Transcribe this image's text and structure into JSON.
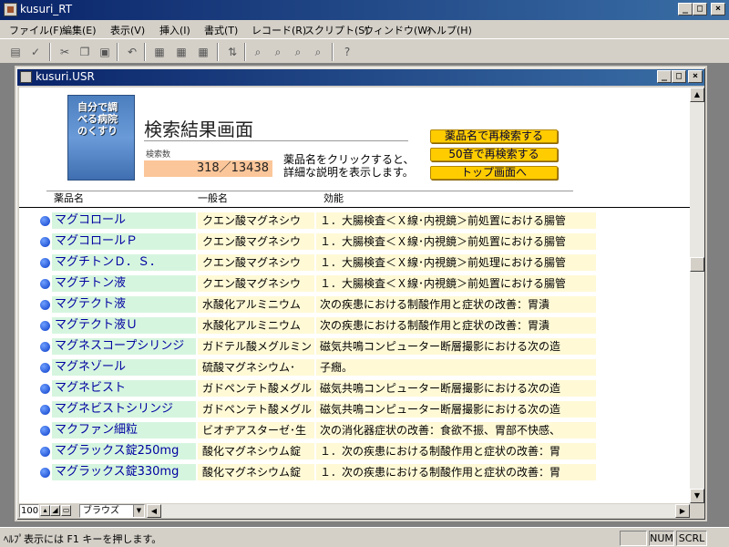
{
  "app": {
    "title": "kusuri_RT"
  },
  "menu": [
    "ファイル(F)",
    "編集(E)",
    "表示(V)",
    "挿入(I)",
    "書式(T)",
    "レコード(R)",
    "スクリプト(S)",
    "ウィンドウ(W)",
    "ヘルプ(H)"
  ],
  "child_window": {
    "title": "kusuri.USR"
  },
  "page": {
    "logo_text": "自分で調べる病院のくすり",
    "title": "検索結果画面",
    "count_label": "検索数",
    "count_value": "318／13438",
    "hint_line1": "薬品名をクリックすると、",
    "hint_line2": "詳細な説明を表示します。",
    "buttons": {
      "research_by_name": "薬品名で再検索する",
      "research_by_kana": "50音で再検索する",
      "top_page": "トップ画面へ"
    },
    "columns": {
      "name": "薬品名",
      "generic": "一般名",
      "effect": "効能"
    }
  },
  "rows": [
    {
      "name": "マグコロール",
      "generic": "クエン酸マグネシウ",
      "effect": "１．大腸検査＜Ｘ線･内視鏡＞前処置における腸管"
    },
    {
      "name": "マグコロールＰ",
      "generic": "クエン酸マグネシウ",
      "effect": "１．大腸検査＜Ｘ線･内視鏡＞前処置における腸管"
    },
    {
      "name": "マグチトンＤ．Ｓ．",
      "generic": "クエン酸マグネシウ",
      "effect": "１．大腸検査＜Ｘ線･内視鏡＞前処理における腸管"
    },
    {
      "name": "マグチトン液",
      "generic": "クエン酸マグネシウ",
      "effect": "１．大腸検査＜Ｘ線･内視鏡＞前処置における腸管"
    },
    {
      "name": "マグテクト液",
      "generic": "水酸化アルミニウム",
      "effect": "次の疾患における制酸作用と症状の改善：胃潰"
    },
    {
      "name": "マグテクト液Ｕ",
      "generic": "水酸化アルミニウム",
      "effect": "次の疾患における制酸作用と症状の改善：胃潰"
    },
    {
      "name": "マグネスコープシリンジ",
      "generic": "ガドテル酸メグルミン",
      "effect": "磁気共鳴コンピューター断層撮影における次の造"
    },
    {
      "name": "マグネゾール",
      "generic": "硫酸マグネシウム･",
      "effect": "子癇。"
    },
    {
      "name": "マグネビスト",
      "generic": "ガドペンテト酸メグル",
      "effect": "磁気共鳴コンピューター断層撮影における次の造"
    },
    {
      "name": "マグネビストシリンジ",
      "generic": "ガドペンテト酸メグル",
      "effect": "磁気共鳴コンピューター断層撮影における次の造"
    },
    {
      "name": "マクファン細粒",
      "generic": "ビオヂアスターゼ･生",
      "effect": "次の消化器症状の改善：食欲不振、胃部不快感、"
    },
    {
      "name": "マグラックス錠250mg",
      "generic": "酸化マグネシウム錠",
      "effect": "１．次の疾患における制酸作用と症状の改善：胃"
    },
    {
      "name": "マグラックス錠330mg",
      "generic": "酸化マグネシウム錠",
      "effect": "１．次の疾患における制酸作用と症状の改善：胃"
    }
  ],
  "bottom": {
    "zoom": "100",
    "browse_mode": "ブラウズ"
  },
  "status": {
    "text": "ﾍﾙﾌﾟ表示には F1 キーを押します。",
    "num": "NUM",
    "scrl": "SCRL"
  }
}
